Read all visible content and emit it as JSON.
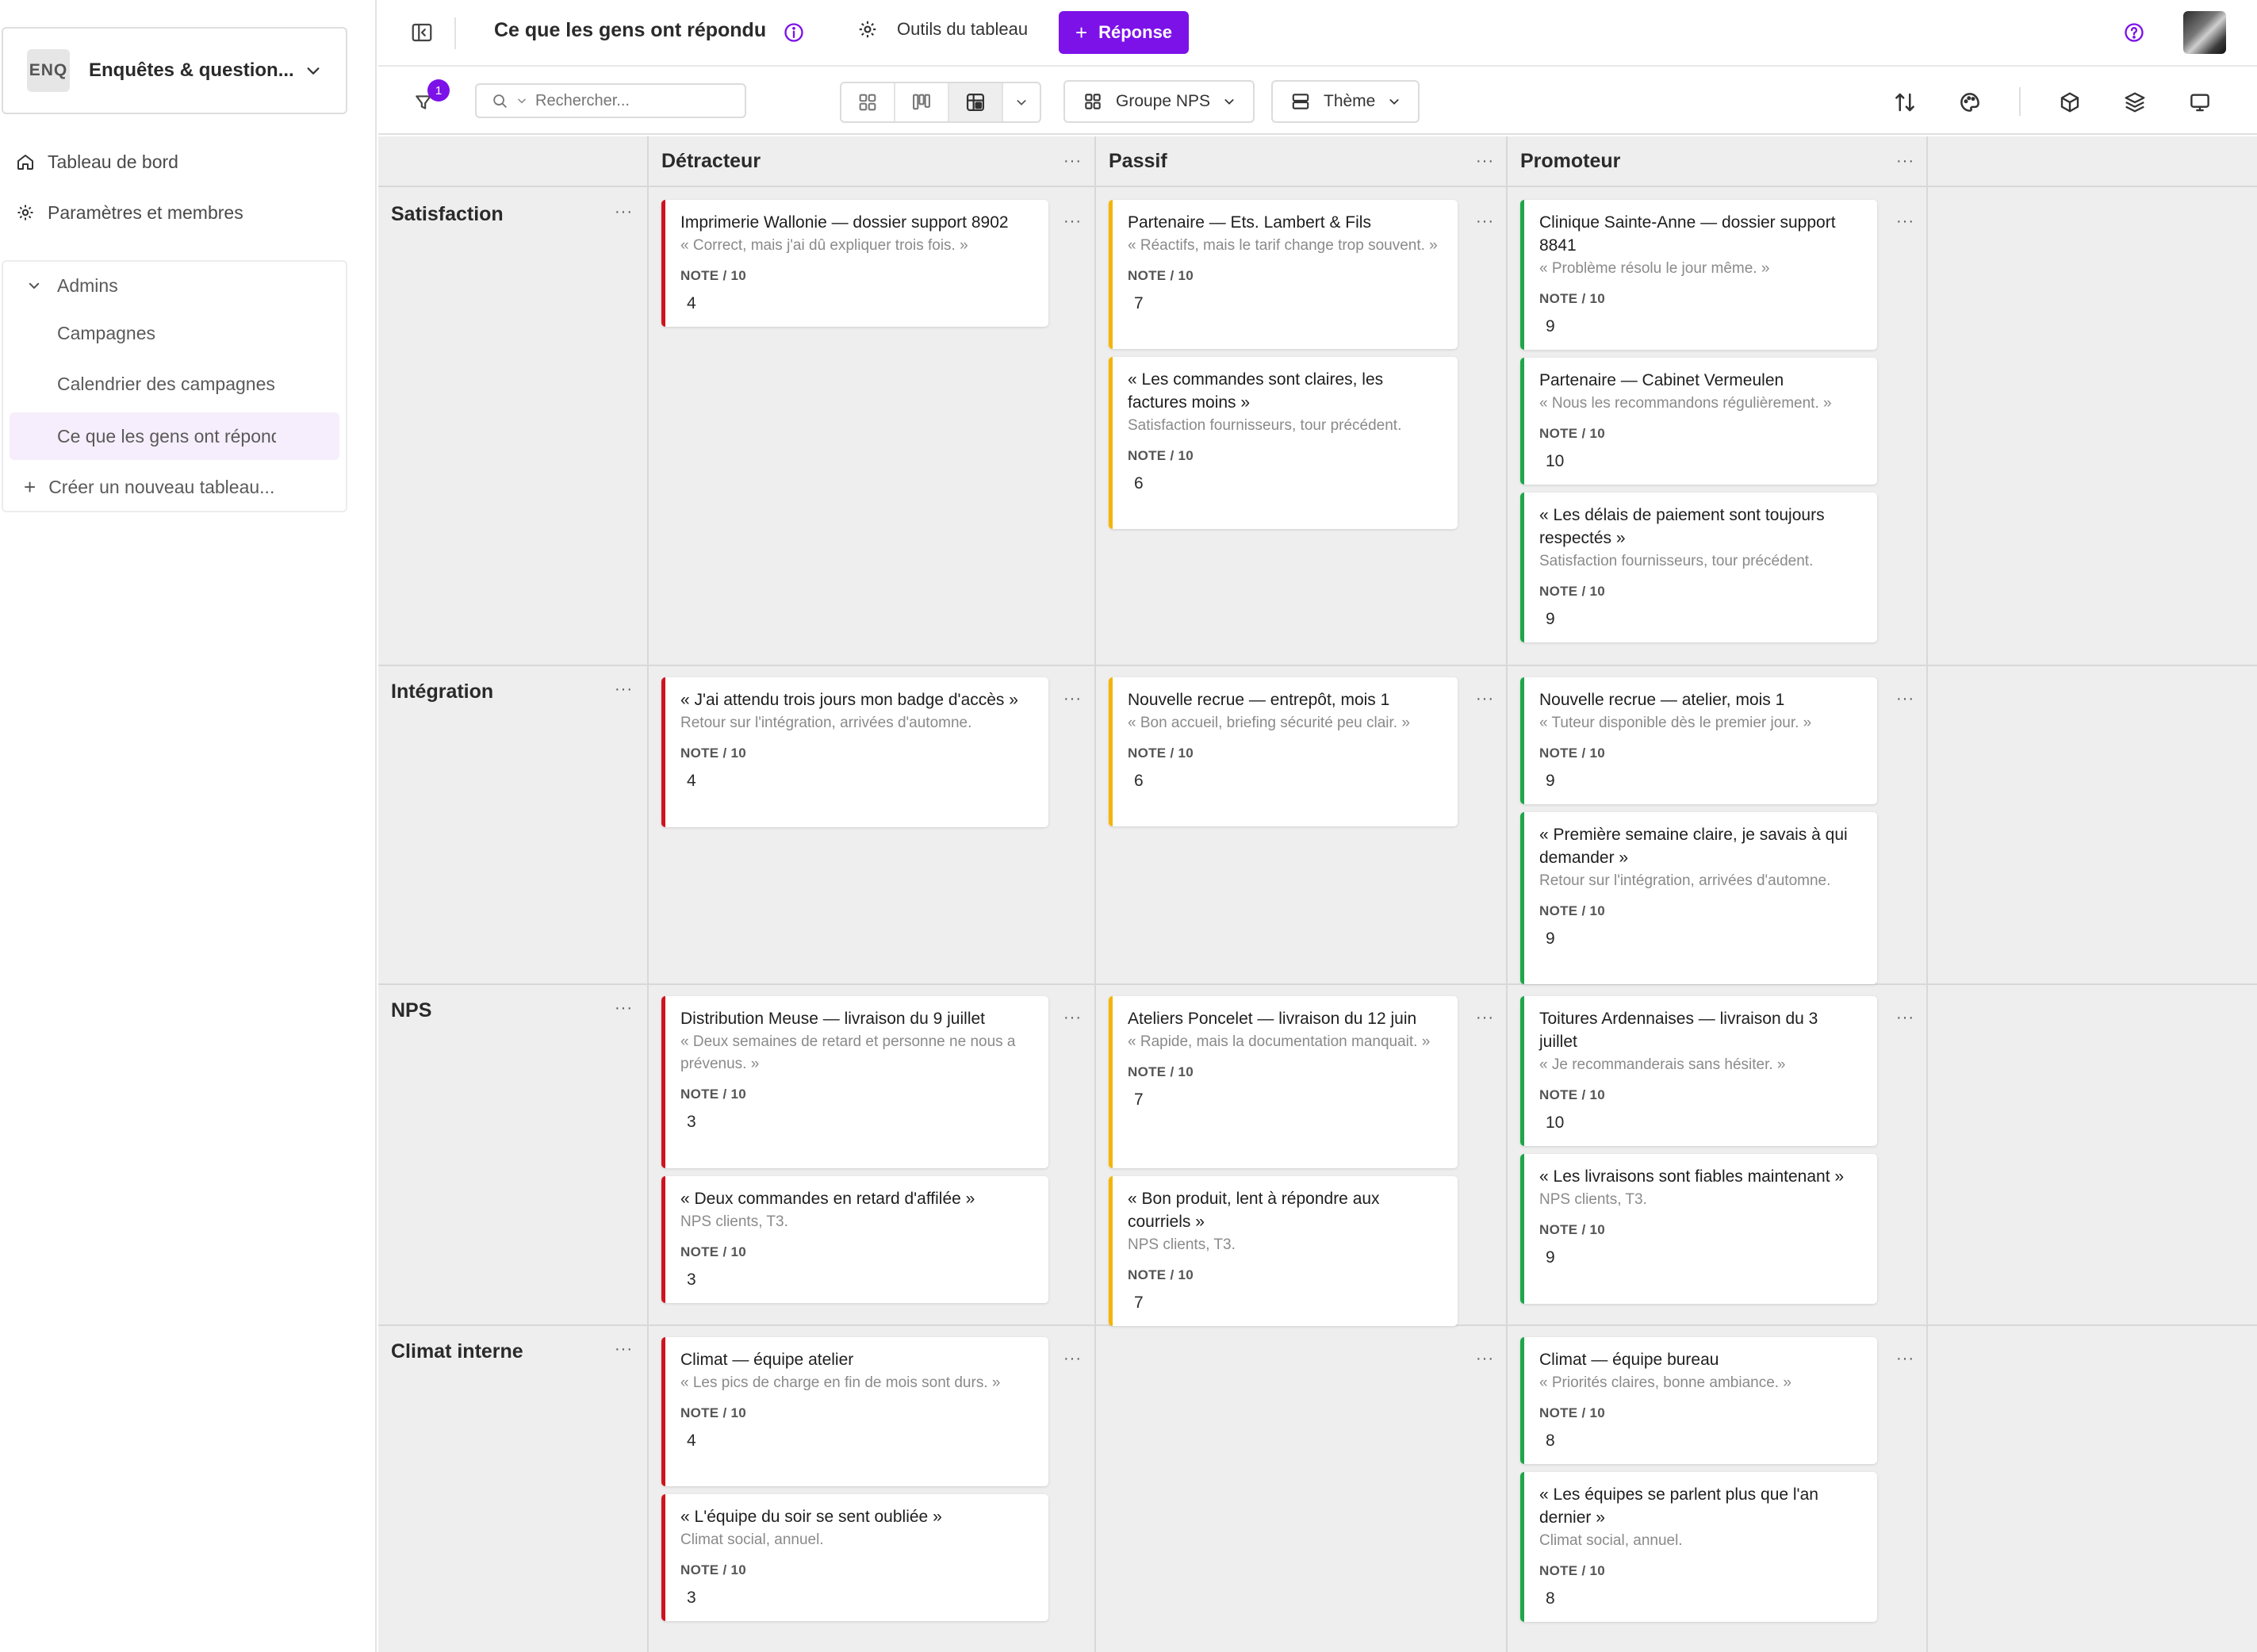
{
  "sidebar": {
    "workspace_badge": "ENQ",
    "workspace_name": "Enquêtes & question...",
    "nav": [
      {
        "label": "Tableau de bord",
        "icon": "home-icon"
      },
      {
        "label": "Paramètres et membres",
        "icon": "gear-icon"
      }
    ],
    "group": {
      "label": "Admins",
      "items": [
        "Campagnes",
        "Calendrier des campagnes",
        "Ce que les gens ont répondu"
      ],
      "active_index": 2
    },
    "create_label": "Créer un nouveau tableau..."
  },
  "topbar": {
    "title": "Ce que les gens ont répondu",
    "tools_label": "Outils du tableau",
    "primary_label": "Réponse",
    "accent_color": "#7c12e8"
  },
  "toolbar": {
    "filter_count": "1",
    "search_placeholder": "Rechercher...",
    "group_label": "Groupe NPS",
    "theme_label": "Thème"
  },
  "board": {
    "metric_label": "NOTE / 10",
    "columns": [
      {
        "label": "Détracteur",
        "color": "#d0141e"
      },
      {
        "label": "Passif",
        "color": "#f5b400"
      },
      {
        "label": "Promoteur",
        "color": "#1fa64a"
      }
    ],
    "rows": [
      {
        "label": "Satisfaction",
        "cells": [
          [
            {
              "title": "Imprimerie Wallonie — dossier support 8902",
              "subtitle": "« Correct, mais j'ai dû expliquer trois fois. »",
              "value": "4"
            }
          ],
          [
            {
              "title": "Partenaire — Ets. Lambert & Fils",
              "subtitle": "« Réactifs, mais le tarif change trop souvent. »",
              "value": "7"
            },
            {
              "title": "« Les commandes sont claires, les factures moins »",
              "subtitle": "Satisfaction fournisseurs, tour précédent.",
              "value": "6"
            }
          ],
          [
            {
              "title": "Clinique Sainte-Anne — dossier support 8841",
              "subtitle": "« Problème résolu le jour même. »",
              "value": "9"
            },
            {
              "title": "Partenaire — Cabinet Vermeulen",
              "subtitle": "« Nous les recommandons régulièrement. »",
              "value": "10"
            },
            {
              "title": "« Les délais de paiement sont toujours respectés »",
              "subtitle": "Satisfaction fournisseurs, tour précédent.",
              "value": "9"
            }
          ]
        ]
      },
      {
        "label": "Intégration",
        "cells": [
          [
            {
              "title": "« J'ai attendu trois jours mon badge d'accès »",
              "subtitle": "Retour sur l'intégration, arrivées d'automne.",
              "value": "4"
            }
          ],
          [
            {
              "title": "Nouvelle recrue — entrepôt, mois 1",
              "subtitle": "« Bon accueil, briefing sécurité peu clair. »",
              "value": "6"
            }
          ],
          [
            {
              "title": "Nouvelle recrue — atelier, mois 1",
              "subtitle": "« Tuteur disponible dès le premier jour. »",
              "value": "9"
            },
            {
              "title": "« Première semaine claire, je savais à qui demander »",
              "subtitle": "Retour sur l'intégration, arrivées d'automne.",
              "value": "9"
            }
          ]
        ]
      },
      {
        "label": "NPS",
        "cells": [
          [
            {
              "title": "Distribution Meuse — livraison du 9 juillet",
              "subtitle": "« Deux semaines de retard et personne ne nous a prévenus. »",
              "value": "3"
            },
            {
              "title": "« Deux commandes en retard d'affilée »",
              "subtitle": "NPS clients, T3.",
              "value": "3"
            }
          ],
          [
            {
              "title": "Ateliers Poncelet — livraison du 12 juin",
              "subtitle": "« Rapide, mais la documentation manquait. »",
              "value": "7"
            },
            {
              "title": "« Bon produit, lent à répondre aux courriels »",
              "subtitle": "NPS clients, T3.",
              "value": "7"
            }
          ],
          [
            {
              "title": "Toitures Ardennaises — livraison du 3 juillet",
              "subtitle": "« Je recommanderais sans hésiter. »",
              "value": "10"
            },
            {
              "title": "« Les livraisons sont fiables maintenant »",
              "subtitle": "NPS clients, T3.",
              "value": "9"
            }
          ]
        ]
      },
      {
        "label": "Climat interne",
        "cells": [
          [
            {
              "title": "Climat — équipe atelier",
              "subtitle": "« Les pics de charge en fin de mois sont durs. »",
              "value": "4"
            },
            {
              "title": "« L'équipe du soir se sent oubliée »",
              "subtitle": "Climat social, annuel.",
              "value": "3"
            }
          ],
          [],
          [
            {
              "title": "Climat — équipe bureau",
              "subtitle": "« Priorités claires, bonne ambiance. »",
              "value": "8"
            },
            {
              "title": "« Les équipes se parlent plus que l'an dernier »",
              "subtitle": "Climat social, annuel.",
              "value": "8"
            }
          ]
        ]
      }
    ]
  }
}
